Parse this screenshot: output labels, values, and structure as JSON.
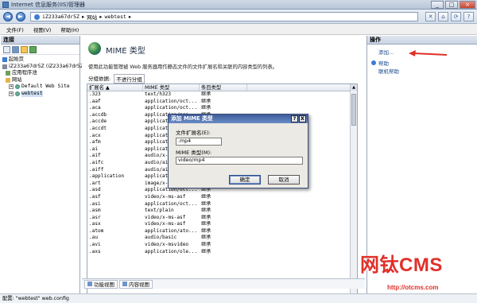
{
  "window": {
    "title": "Internet 信息服务(IIS)管理器",
    "buttons": {
      "minimize": "_",
      "maximize": "□",
      "close": "×"
    }
  },
  "address_bar": {
    "back_icon": "back-arrow",
    "forward_icon": "forward-arrow",
    "breadcrumb": [
      "iZ233a67dr5Z",
      "网站",
      "webtest"
    ],
    "separator": "▸",
    "tools": [
      "stop-icon",
      "home-icon",
      "refresh-icon",
      "help-icon"
    ],
    "tool_glyphs": [
      "✕",
      "⌂",
      "⟳",
      "?"
    ]
  },
  "menu": [
    "文件(F)",
    "视图(V)",
    "帮助(H)"
  ],
  "connections": {
    "header": "连接",
    "tree": [
      {
        "label": "起始页",
        "icon": "start-page-icon",
        "level": 0,
        "expander": ""
      },
      {
        "label": "iZ233a67dr5Z (iZ233a67dr5Z",
        "icon": "server-icon",
        "level": 0,
        "expander": ""
      },
      {
        "label": "应用程序池",
        "icon": "app-pool-icon",
        "level": 1,
        "expander": ""
      },
      {
        "label": "网站",
        "icon": "sites-folder-icon",
        "level": 1,
        "expander": ""
      },
      {
        "label": "Default Web Site",
        "icon": "website-icon",
        "level": 2,
        "expander": "+"
      },
      {
        "label": "webtest",
        "icon": "website-icon",
        "level": 2,
        "expander": "+",
        "selected": true
      }
    ]
  },
  "feature": {
    "title": "MIME 类型",
    "description": "使用此功能管理被 Web 服务器用作静态文件的文件扩展名和关联的内容类型的列表。",
    "group_by_label": "分组依据:",
    "group_by_value": "不进行分组"
  },
  "grid": {
    "columns": [
      "扩展名 ▲",
      "MIME 类型",
      "条目类型"
    ],
    "rows": [
      [
        ".323",
        "text/h323",
        "继承"
      ],
      [
        ".aaf",
        "application/oct...",
        "继承"
      ],
      [
        ".aca",
        "application/oct...",
        "继承"
      ],
      [
        ".accdb",
        "application/msa...",
        "继承"
      ],
      [
        ".accde",
        "application/msa...",
        "继承"
      ],
      [
        ".accdt",
        "application/msa...",
        "继承"
      ],
      [
        ".acx",
        "application/int...",
        "继承"
      ],
      [
        ".afm",
        "application/oct...",
        "继承"
      ],
      [
        ".ai",
        "application/pos...",
        "继承"
      ],
      [
        ".aif",
        "audio/x-aiff",
        "继承"
      ],
      [
        ".aifc",
        "audio/aiff",
        "继承"
      ],
      [
        ".aiff",
        "audio/aiff",
        "继承"
      ],
      [
        ".application",
        "application/x-m...",
        "继承"
      ],
      [
        ".art",
        "image/x-jg",
        "继承"
      ],
      [
        ".asd",
        "application/oct...",
        "继承"
      ],
      [
        ".asf",
        "video/x-ms-asf",
        "继承"
      ],
      [
        ".asi",
        "application/oct...",
        "继承"
      ],
      [
        ".asm",
        "text/plain",
        "继承"
      ],
      [
        ".asr",
        "video/x-ms-asf",
        "继承"
      ],
      [
        ".asx",
        "video/x-ms-asf",
        "继承"
      ],
      [
        ".atom",
        "application/ato...",
        "继承"
      ],
      [
        ".au",
        "audio/basic",
        "继承"
      ],
      [
        ".avi",
        "video/x-msvideo",
        "继承"
      ],
      [
        ".axs",
        "application/ole...",
        "继承"
      ]
    ]
  },
  "view_tabs": [
    "功能视图",
    "内容视图"
  ],
  "actions": {
    "header": "操作",
    "items": [
      {
        "label": "添加...",
        "icon": ""
      },
      {
        "label": "帮助",
        "icon": "help-icon"
      },
      {
        "label": "联机帮助",
        "icon": ""
      }
    ]
  },
  "status": "配置: \"webtest\" web.config",
  "dialog": {
    "title": "添加 MIME 类型",
    "help_button": "?",
    "close_button": "X",
    "ext_label": "文件扩展名(E):",
    "ext_value": ".mp4",
    "mime_label": "MIME 类型(M):",
    "mime_value": "video/mp4",
    "ok_label": "确定",
    "cancel_label": "取消"
  },
  "watermark": {
    "logo": "网钛CMS",
    "url": "http://otcms.com"
  },
  "colors": {
    "accent": "#3a7bd5",
    "watermark": "#e0302a",
    "arrow": "#e0302a"
  }
}
